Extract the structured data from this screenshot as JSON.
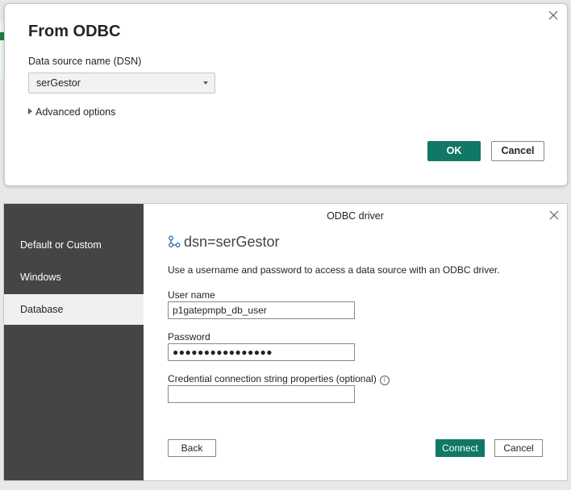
{
  "top_dialog": {
    "title": "From ODBC",
    "dsn_label": "Data source name (DSN)",
    "dsn_value": "serGestor",
    "advanced_options": "Advanced options",
    "ok_label": "OK",
    "cancel_label": "Cancel"
  },
  "odbc_dialog": {
    "header": "ODBC driver",
    "nav": [
      "Default or Custom",
      "Windows",
      "Database"
    ],
    "selected_nav": "Database",
    "dsn_title": "dsn=serGestor",
    "description": "Use a username and password to access a data source with an ODBC driver.",
    "username_label": "User name",
    "username_value": "p1gatepmpb_db_user",
    "password_label": "Password",
    "password_value": "●●●●●●●●●●●●●●●●",
    "credential_label": "Credential connection string properties (optional)",
    "credential_value": "",
    "back_label": "Back",
    "connect_label": "Connect",
    "cancel_label": "Cancel"
  },
  "colors": {
    "accent": "#117865",
    "sidebar": "#454545"
  }
}
